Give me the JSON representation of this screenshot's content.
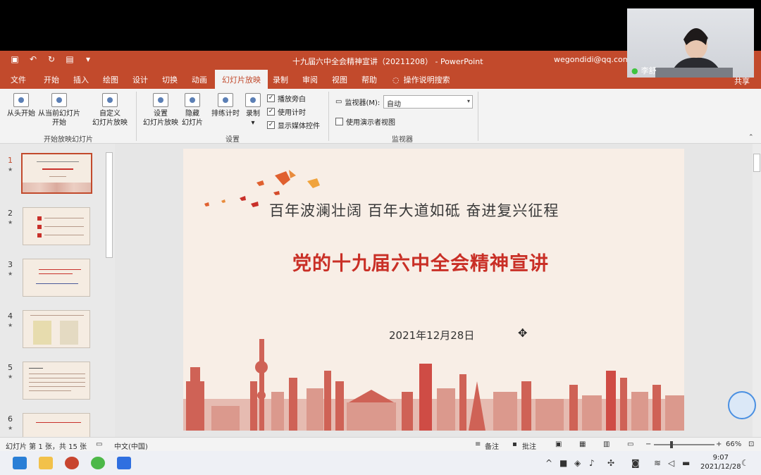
{
  "window": {
    "title": "十九届六中全会精神宣讲（20211208） - PowerPoint",
    "account": "wegondidi@qq.com"
  },
  "tabs": [
    "文件",
    "开始",
    "插入",
    "绘图",
    "设计",
    "切换",
    "动画",
    "幻灯片放映",
    "录制",
    "审阅",
    "视图",
    "帮助"
  ],
  "tell_me": "操作说明搜索",
  "share_label": "共享",
  "ribbon": {
    "from_start": "从头开始",
    "from_current_1": "从当前幻灯片",
    "from_current_2": "开始",
    "custom_1": "自定义",
    "custom_2": "幻灯片放映",
    "group_start": "开始放映幻灯片",
    "setup_1": "设置",
    "setup_2": "幻灯片放映",
    "hide_1": "隐藏",
    "hide_2": "幻灯片",
    "rehearse": "排练计时",
    "record": "录制",
    "play_narrations": "播放旁白",
    "use_timings": "使用计时",
    "show_media_controls": "显示媒体控件",
    "group_setup": "设置",
    "monitor_label": "监视器(M):",
    "monitor_value": "自动",
    "presenter_view": "使用演示者视图",
    "group_monitor": "监视器"
  },
  "thumbnails": [
    "1",
    "2",
    "3",
    "4",
    "5",
    "6"
  ],
  "slide": {
    "subtitle": "百年波澜壮阔  百年大道如砥  奋进复兴征程",
    "title": "党的十九届六中全会精神宣讲",
    "date": "2021年12月28日"
  },
  "status": {
    "slide_info": "幻灯片 第 1 张，共 15 张",
    "language": "中文(中国)",
    "notes": "备注",
    "comments": "批注",
    "zoom": "66%"
  },
  "taskbar": {
    "time": "9:07",
    "date": "2021/12/28"
  },
  "camera": {
    "name": "李舒"
  }
}
